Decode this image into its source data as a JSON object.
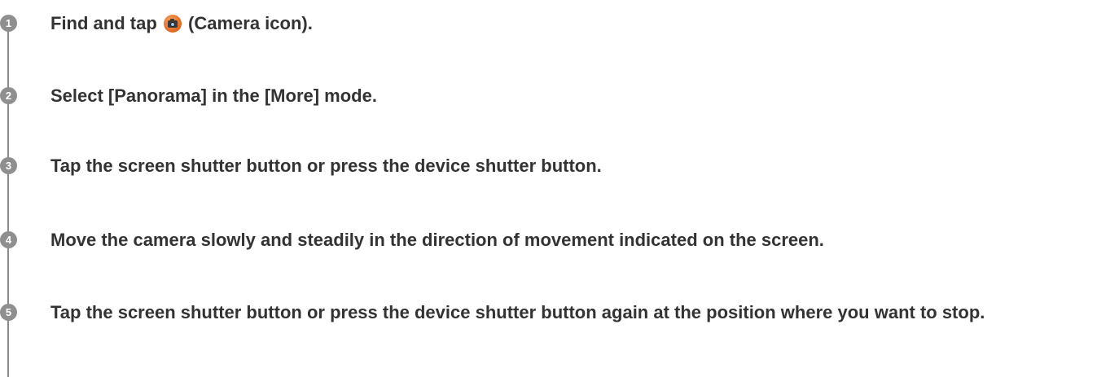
{
  "steps": [
    {
      "number": "1",
      "text_before": "Find and tap",
      "icon": "camera-icon",
      "text_after": "(Camera icon)."
    },
    {
      "number": "2",
      "text": "Select [Panorama] in the [More] mode."
    },
    {
      "number": "3",
      "text": "Tap the screen shutter button or press the device shutter button."
    },
    {
      "number": "4",
      "text": "Move the camera slowly and steadily in the direction of movement indicated on the screen."
    },
    {
      "number": "5",
      "text": "Tap the screen shutter button or press the device shutter button again at the position where you want to stop."
    }
  ],
  "colors": {
    "step_badge": "#8f8f8f",
    "timeline": "#8a8a8a",
    "text": "#333333",
    "camera_icon": "#e2702a"
  }
}
